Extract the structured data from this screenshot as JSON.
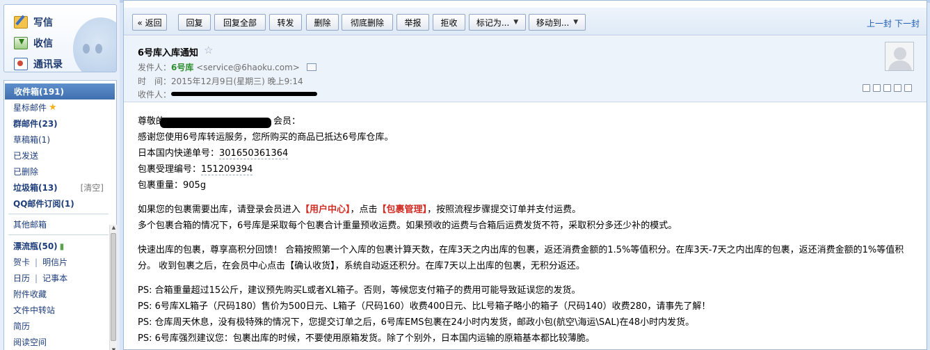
{
  "sidebar": {
    "quick": {
      "write": "写信",
      "receive": "收信",
      "contacts": "通讯录"
    },
    "folders": {
      "inbox": "收件箱(191)",
      "starred": "星标邮件",
      "group": "群邮件(23)",
      "drafts": "草稿箱(1)",
      "sent": "已发送",
      "deleted": "已删除",
      "spam": "垃圾箱(13)",
      "spam_clear": "[清空]",
      "qq_subscription": "QQ邮件订阅(1)",
      "other": "其他邮箱",
      "drift_bottle": "漂流瓶(50)",
      "cards": "贺卡",
      "postcards": "明信片",
      "calendar": "日历",
      "notebook": "记事本",
      "attachments": "附件收藏",
      "file_transfer": "文件中转站",
      "resume": "简历",
      "reading": "阅读空间"
    }
  },
  "toolbar": {
    "back": "« 返回",
    "reply": "回复",
    "reply_all": "回复全部",
    "forward": "转发",
    "delete": "删除",
    "delete_forever": "彻底删除",
    "report": "举报",
    "reject": "拒收",
    "mark_as": "标记为...",
    "move_to": "移动到...",
    "prev": "上一封",
    "next": "下一封"
  },
  "email": {
    "subject": "6号库入库通知",
    "from_label": "发件人：",
    "from_name": "6号库",
    "from_email": "<service@6haoku.com>",
    "time_label": "时　间：",
    "time_value": "2015年12月9日(星期三) 晚上9:14",
    "to_label": "收件人：",
    "body": {
      "greeting_a": "尊敬的",
      "greeting_b": "会员：",
      "line1": "感谢您使用6号库转运服务，您所购买的商品已抵达6号库仓库。",
      "tracking_label": "日本国内快递单号：",
      "tracking_no": "301650361364",
      "package_label": "包裹受理编号：",
      "package_no": "151209394",
      "weight_label": "包裹重量：",
      "weight_value": "905g",
      "p2_a": "如果您的包裹需要出库，请登录会员进入",
      "p2_link1": "【用户中心】",
      "p2_b": "，点击",
      "p2_link2": "【包裹管理】",
      "p2_c": "，按照流程步骤提交订单并支付运费。",
      "p2_line2": "多个包裹合箱的情况下，6号库是采取每个包裹合计重量预收运费。如果预收的运费与合箱后运费发货不符，采取积分多还少补的模式。",
      "p3": "快速出库的包裹，尊享高积分回馈！ 合箱按照第一个入库的包裹计算天数，在库3天之内出库的包裹，返还消费金额的1.5%等值积分。在库3天-7天之内出库的包裹，返还消费金额的1%等值积分。 收到包裹之后，在会员中心点击【确认收货】，系统自动返还积分。在库7天以上出库的包裹，无积分返还。",
      "ps1": "PS: 合箱重量超过15公斤，建议预先购买L或者XL箱子。否则，等候您支付箱子的费用可能导致延误您的发货。",
      "ps2": "PS: 6号库XL箱子（尺码180）售价为500日元、L箱子（尺码160）收费400日元、比L号箱子略小的箱子（尺码140）收费280，请事先了解！",
      "ps3": "PS: 仓库周天休息，没有极特殊的情况下，您提交订单之后，6号库EMS包裹在24小时内发货，邮政小包(航空\\海运\\SAL)在48小时内发货。",
      "ps4": "PS: 6号库强烈建议您：包裹出库的时候，不要使用原箱发货。除了个别外，日本国内运输的原箱基本都比较薄脆。"
    }
  }
}
